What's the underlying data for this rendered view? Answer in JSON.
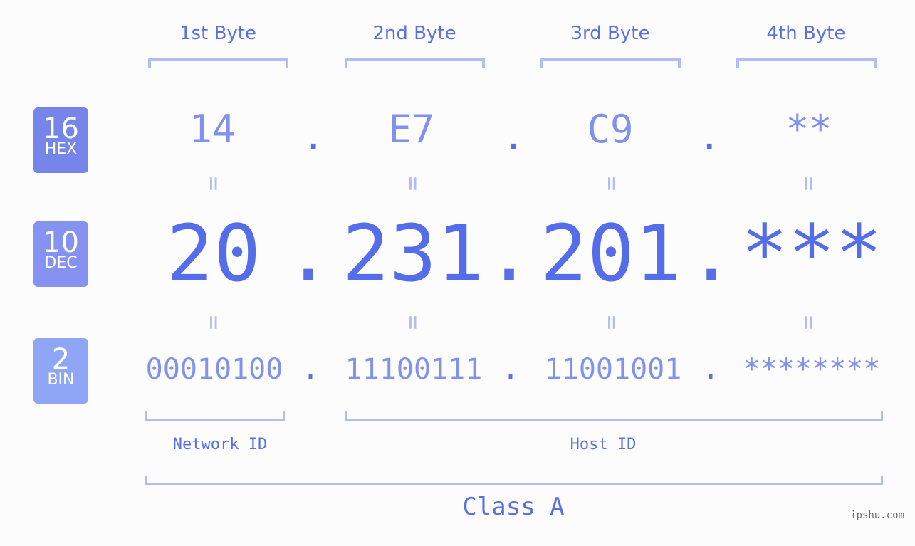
{
  "bytes": {
    "labels": [
      "1st Byte",
      "2nd Byte",
      "3rd Byte",
      "4th Byte"
    ]
  },
  "badges": {
    "hex": {
      "num": "16",
      "label": "HEX",
      "color": "#7585ea"
    },
    "dec": {
      "num": "10",
      "label": "DEC",
      "color": "#8592f1"
    },
    "bin": {
      "num": "2",
      "label": "BIN",
      "color": "#8fa6f7"
    }
  },
  "hex": {
    "values": [
      "14",
      "E7",
      "C9",
      "**"
    ]
  },
  "dec": {
    "values": [
      "20",
      "231",
      "201",
      "***"
    ]
  },
  "bin": {
    "values": [
      "00010100",
      "11100111",
      "11001001",
      "********"
    ]
  },
  "separator": ".",
  "equals": "=",
  "segments": {
    "network": "Network ID",
    "host": "Host ID"
  },
  "class_label": "Class A",
  "watermark": "ipshu.com",
  "colors": {
    "accent": "#566deb",
    "light": "#8290ee",
    "bracket": "#b3bcf7",
    "background": "#fbfcfb"
  }
}
